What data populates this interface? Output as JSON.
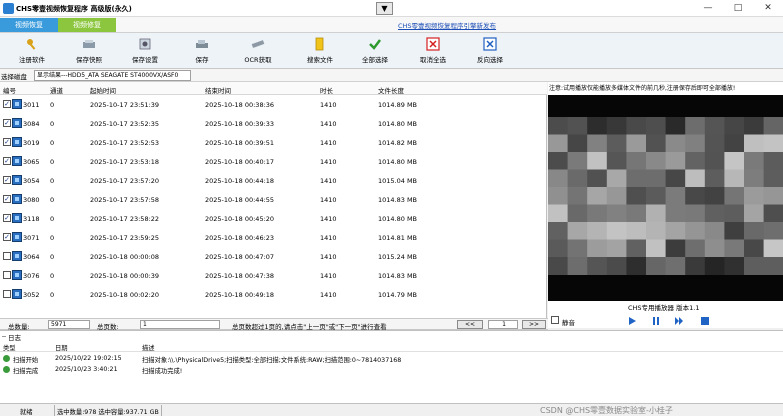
{
  "window": {
    "title": "CHS零壹视频恢复程序 高级版(永久)",
    "collapse_glyph": "▼",
    "minimize": "—",
    "maximize": "□",
    "close": "✕"
  },
  "tabs": [
    {
      "label": "视频恢复"
    },
    {
      "label": "视频修复"
    }
  ],
  "promo_link": "CHS零壹视频恢复程序引擎新发布",
  "toolbar": [
    {
      "label": "注册软件",
      "icon": "register-icon"
    },
    {
      "label": "保存快照",
      "icon": "snapshot-icon"
    },
    {
      "label": "保存设置",
      "icon": "settings-icon"
    },
    {
      "label": "保存",
      "icon": "save-icon"
    },
    {
      "label": "OCR获取",
      "icon": "ocr-icon"
    },
    {
      "label": "搜索文件",
      "icon": "search-folder-icon"
    },
    {
      "label": "全部选择",
      "icon": "check-all-icon"
    },
    {
      "label": "取消全选",
      "icon": "uncheck-all-icon"
    },
    {
      "label": "反向选择",
      "icon": "invert-selection-icon"
    }
  ],
  "disk": {
    "label": "选择磁盘",
    "value": "显示结果---HDD5_ATA     SEAGATE ST4000VX/ASF0"
  },
  "table": {
    "columns": [
      "编号",
      "通道",
      "起始时间",
      "结束时间",
      "时长",
      "文件长度"
    ],
    "rows": [
      {
        "checked": true,
        "id": "3011",
        "channel": "0",
        "start": "2025-10-17 23:51:39",
        "end": "2025-10-18 00:38:36",
        "duration": "1410",
        "size": "1014.89 MB"
      },
      {
        "checked": true,
        "id": "3084",
        "channel": "0",
        "start": "2025-10-17 23:52:35",
        "end": "2025-10-18 00:39:33",
        "duration": "1410",
        "size": "1014.80 MB"
      },
      {
        "checked": true,
        "id": "3019",
        "channel": "0",
        "start": "2025-10-17 23:52:53",
        "end": "2025-10-18 00:39:51",
        "duration": "1410",
        "size": "1014.82 MB"
      },
      {
        "checked": true,
        "id": "3065",
        "channel": "0",
        "start": "2025-10-17 23:53:18",
        "end": "2025-10-18 00:40:17",
        "duration": "1410",
        "size": "1014.80 MB"
      },
      {
        "checked": true,
        "id": "3054",
        "channel": "0",
        "start": "2025-10-17 23:57:20",
        "end": "2025-10-18 00:44:18",
        "duration": "1410",
        "size": "1015.04 MB"
      },
      {
        "checked": true,
        "id": "3080",
        "channel": "0",
        "start": "2025-10-17 23:57:58",
        "end": "2025-10-18 00:44:55",
        "duration": "1410",
        "size": "1014.83 MB"
      },
      {
        "checked": true,
        "id": "3118",
        "channel": "0",
        "start": "2025-10-17 23:58:22",
        "end": "2025-10-18 00:45:20",
        "duration": "1410",
        "size": "1014.80 MB"
      },
      {
        "checked": true,
        "id": "3071",
        "channel": "0",
        "start": "2025-10-17 23:59:25",
        "end": "2025-10-18 00:46:23",
        "duration": "1410",
        "size": "1014.81 MB"
      },
      {
        "checked": false,
        "id": "3064",
        "channel": "0",
        "start": "2025-10-18 00:00:08",
        "end": "2025-10-18 00:47:07",
        "duration": "1410",
        "size": "1015.24 MB"
      },
      {
        "checked": false,
        "id": "3076",
        "channel": "0",
        "start": "2025-10-18 00:00:39",
        "end": "2025-10-18 00:47:38",
        "duration": "1410",
        "size": "1014.83 MB"
      },
      {
        "checked": false,
        "id": "3052",
        "channel": "0",
        "start": "2025-10-18 00:02:20",
        "end": "2025-10-18 00:49:18",
        "duration": "1410",
        "size": "1014.79 MB"
      }
    ]
  },
  "preview": {
    "tip": "注意:试用播放仅能播放多媒体文件的前几秒,注册保存后即可全部播放!",
    "player_name": "CHS专用播放器 版本1.1",
    "mute_label": "静音"
  },
  "pager": {
    "total_label": "总数量:",
    "total_value": "5971",
    "pages_label": "总页数:",
    "pages_value": "1",
    "notice": "总页数超过1页的,请点击\"上一页\"或\"下一页\"进行查看",
    "prev": "<<",
    "current": "1",
    "next": ">>"
  },
  "log": {
    "title": "日志",
    "columns": [
      "类型",
      "日期",
      "描述"
    ],
    "rows": [
      {
        "type": "扫描开始",
        "date": "2025/10/22 19:02:15",
        "desc": "扫描对象:\\\\.\\PhysicalDrive5;扫描类型:全部扫描;文件系统:RAW;扫描范围:0~7814037168"
      },
      {
        "type": "扫描完成",
        "date": "2025/10/23 3:40:21",
        "desc": "扫描成功完成!"
      }
    ]
  },
  "status": {
    "ready": "就绪",
    "selection": "选中数量:978 选中容量:937.71 GB",
    "watermark": "CSDN @CHS零壹数据实验室-小桂子"
  },
  "colors": {
    "tab_blue": "#3a9bdc",
    "tab_green": "#8cc63f",
    "link_blue": "#1a4db5"
  }
}
